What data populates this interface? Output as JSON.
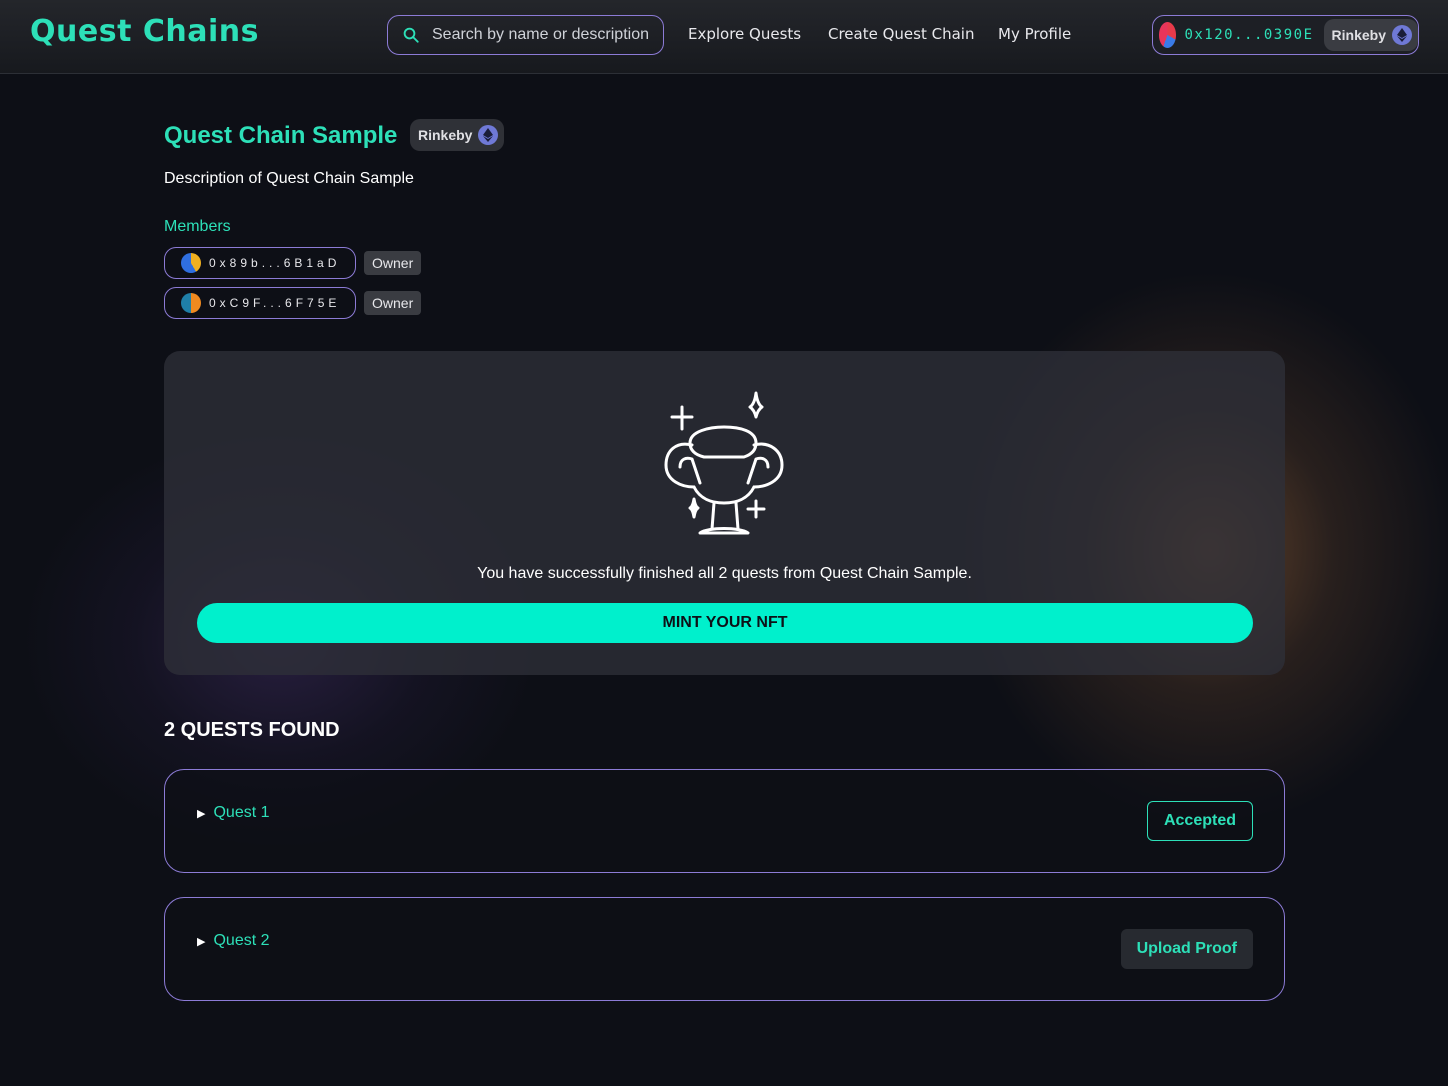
{
  "header": {
    "logo": "Quest Chains",
    "search_placeholder": "Search by name or description",
    "nav": [
      "Explore Quests",
      "Create Quest Chain",
      "My Profile"
    ],
    "wallet": {
      "address": "0x120...0390E",
      "network": "Rinkeby"
    }
  },
  "chain": {
    "title": "Quest Chain Sample",
    "network": "Rinkeby",
    "description": "Description of Quest Chain Sample",
    "members_label": "Members",
    "members": [
      {
        "address": "0x89b...6B1aD",
        "role": "Owner"
      },
      {
        "address": "0xC9F...6F75E",
        "role": "Owner"
      }
    ]
  },
  "completion": {
    "message": "You have successfully finished all 2 quests from Quest Chain Sample.",
    "mint_label": "MINT YOUR NFT"
  },
  "quests": {
    "count_label": "2 QUESTS FOUND",
    "items": [
      {
        "name": "Quest 1",
        "action": "Accepted"
      },
      {
        "name": "Quest 2",
        "action": "Upload Proof"
      }
    ]
  },
  "colors": {
    "accent": "#2de0b8",
    "mint_button": "#00f0cc",
    "border_purple": "#8c7bd6",
    "background": "#0d0f16"
  },
  "icons": [
    "search-icon",
    "ethereum-icon",
    "trophy-icon",
    "sparkle-icon",
    "triangle-right-icon"
  ]
}
